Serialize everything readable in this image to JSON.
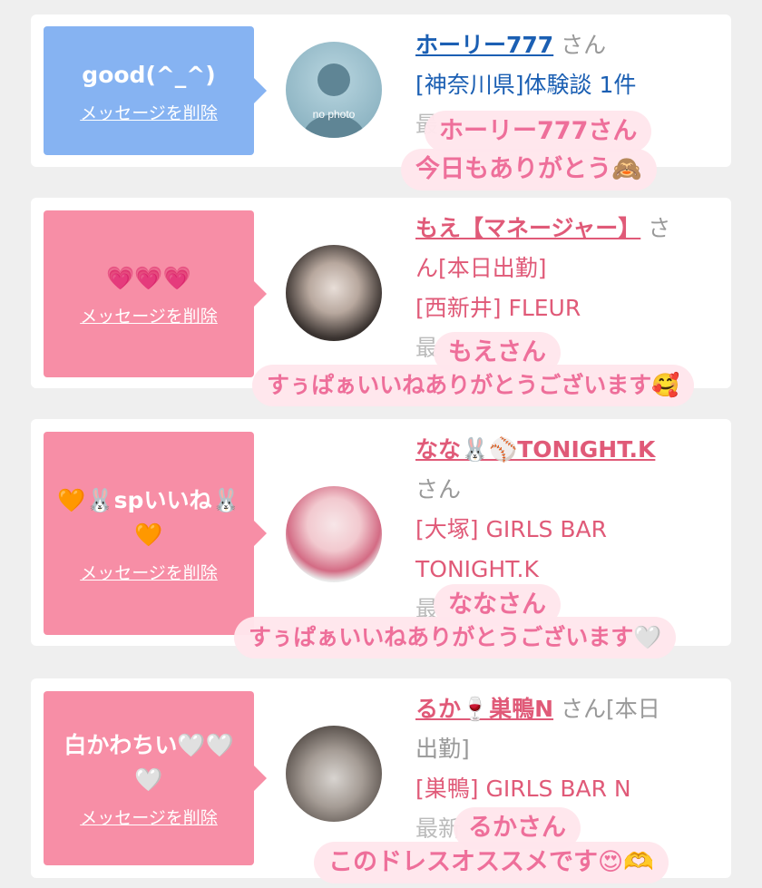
{
  "colors": {
    "blue_bubble": "#86b3f2",
    "pink_bubble": "#f78ea6",
    "name_pink": "#e05a78",
    "name_blue": "#1b5fb3",
    "toast_text": "#ee6f9a"
  },
  "cards": [
    {
      "message": "good(^_^)",
      "delete_label": "メッセージを削除",
      "name": "ホーリー777",
      "suffix": "さん",
      "line2": "[神奈川県]体験談 1件",
      "line3": "最",
      "avatar_label": "no photo"
    },
    {
      "message": "💗💗💗",
      "delete_label": "メッセージを削除",
      "name": "もえ【マネージャー】",
      "suffix": "さ",
      "line2": "ん[本日出勤]",
      "line3": "[西新井] FLEUR",
      "line4": "最"
    },
    {
      "message": "🧡🐰spいいね🐰🧡",
      "delete_label": "メッセージを削除",
      "name": "なな🐰⚾TONIGHT.K",
      "suffix": "さん",
      "line2": "[大塚] GIRLS BAR",
      "line3": "TONIGHT.K",
      "line4": "最"
    },
    {
      "message": "白かわちい🤍🤍🤍",
      "delete_label": "メッセージを削除",
      "name": "るか🍷巣鴨N",
      "suffix": "さん[本日",
      "line2": "出勤]",
      "line3": "[巣鴨] GIRLS BAR N",
      "line4": "最新"
    }
  ],
  "toasts": [
    {
      "line1": "ホーリー777さん",
      "line2": "今日もありがとう🙈"
    },
    {
      "line1": "もえさん",
      "line2": "すぅぱぁいいねありがとうございます🥰"
    },
    {
      "line1": "ななさん",
      "line2": "すぅぱぁいいねありがとうございます🤍"
    },
    {
      "line1": "るかさん",
      "line2": "このドレスオススメです😍🫶"
    }
  ]
}
